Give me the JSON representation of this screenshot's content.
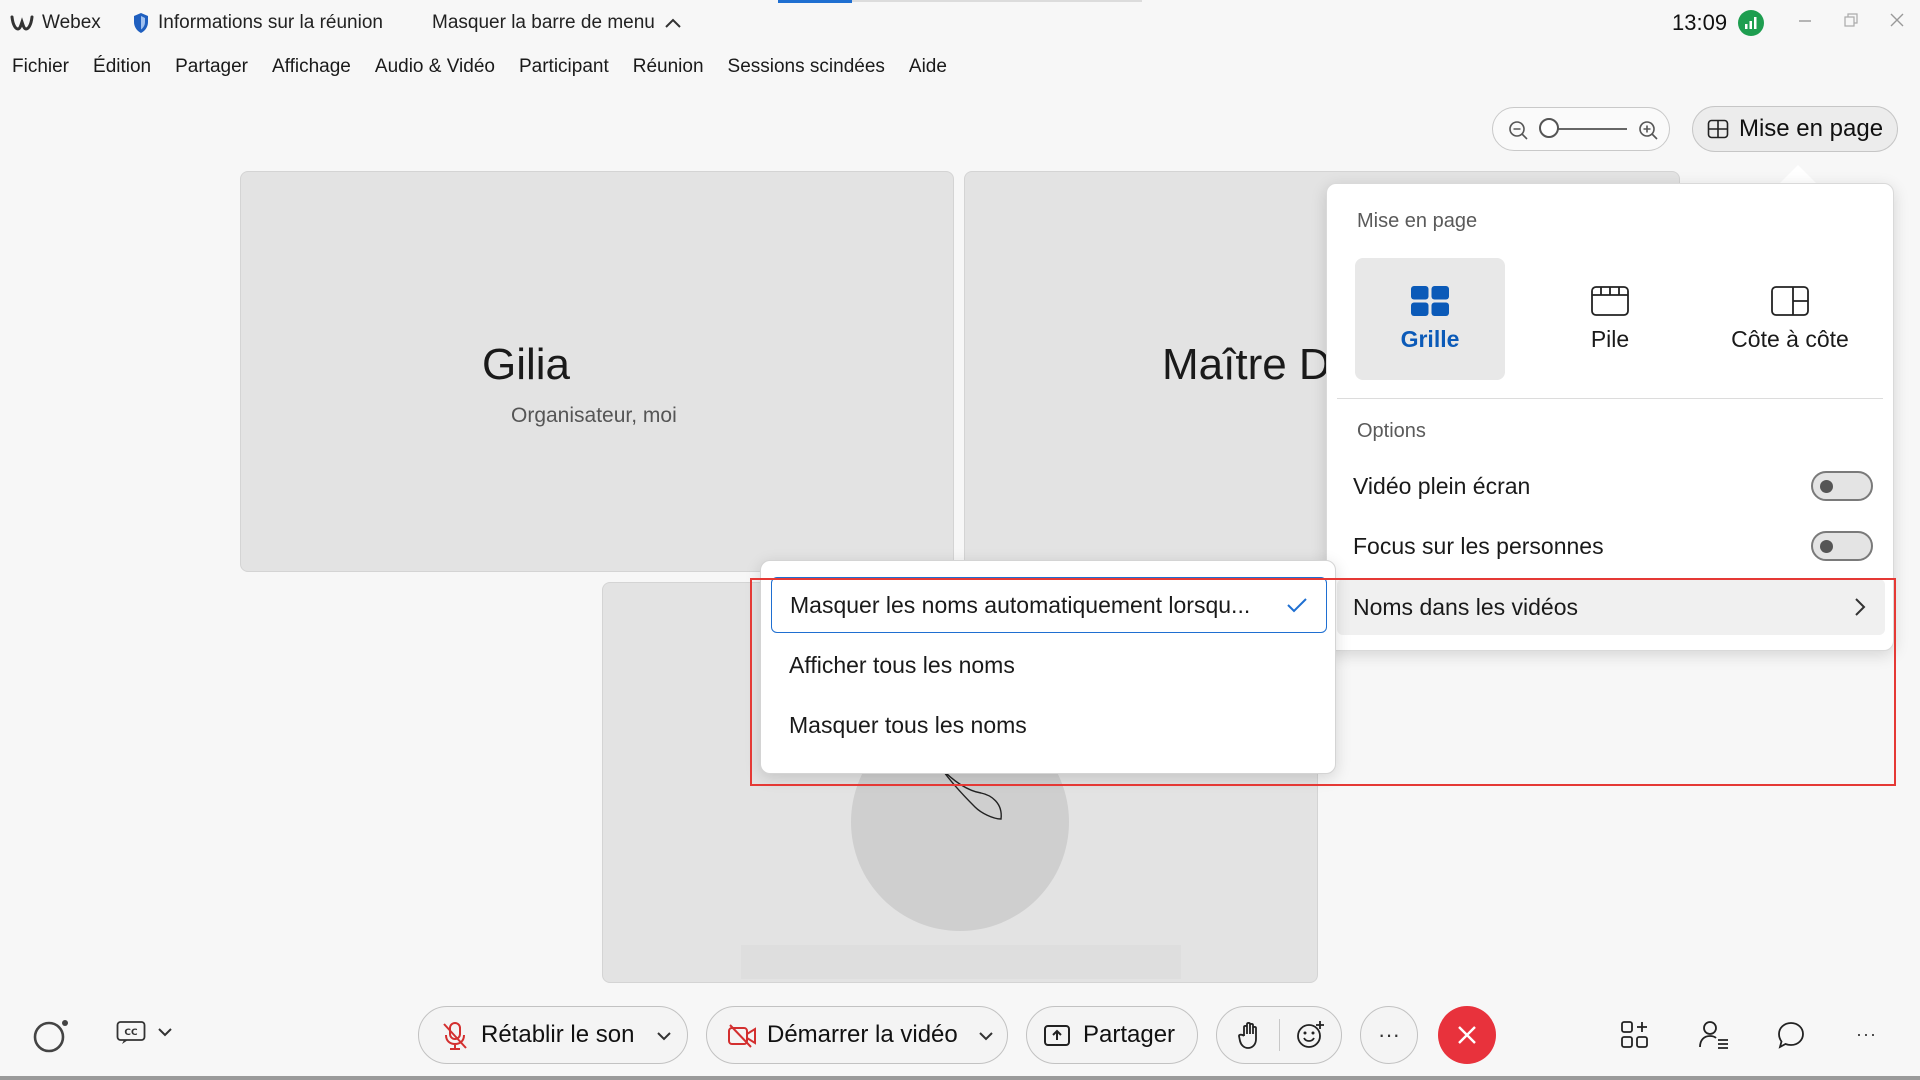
{
  "titlebar": {
    "app_name": "Webex",
    "meeting_info": "Informations sur la réunion",
    "hide_menubar": "Masquer la barre de menu",
    "time": "13:09"
  },
  "menubar": {
    "items": [
      "Fichier",
      "Édition",
      "Partager",
      "Affichage",
      "Audio & Vidéo",
      "Participant",
      "Réunion",
      "Sessions scindées",
      "Aide"
    ]
  },
  "zoom": {
    "level": 0.0
  },
  "layout_button": {
    "label": "Mise en page"
  },
  "tiles": {
    "tile1": {
      "name": "Gilia",
      "role": "Organisateur, moi"
    },
    "tile2": {
      "name": "Maître D"
    }
  },
  "layout_panel": {
    "heading": "Mise en page",
    "layouts": [
      {
        "label": "Grille",
        "icon": "grid-icon",
        "selected": true
      },
      {
        "label": "Pile",
        "icon": "stack-icon",
        "selected": false
      },
      {
        "label": "Côte à côte",
        "icon": "side-by-side-icon",
        "selected": false
      }
    ],
    "options_heading": "Options",
    "options": [
      {
        "label": "Vidéo plein écran",
        "on": false
      },
      {
        "label": "Focus sur les personnes",
        "on": false
      }
    ],
    "names_in_videos": "Noms dans les vidéos"
  },
  "names_submenu": {
    "items": [
      {
        "label": "Masquer les noms automatiquement lorsqu...",
        "selected": true
      },
      {
        "label": "Afficher tous les noms",
        "selected": false
      },
      {
        "label": "Masquer tous les noms",
        "selected": false
      }
    ]
  },
  "toolbar": {
    "unmute": "Rétablir le son",
    "start_video": "Démarrer la vidéo",
    "share": "Partager",
    "more": "···"
  },
  "colors": {
    "accent_blue": "#0b5ab8",
    "end_call_red": "#e8323c",
    "highlight_red": "#e53935",
    "signal_green": "#1e9e50"
  }
}
